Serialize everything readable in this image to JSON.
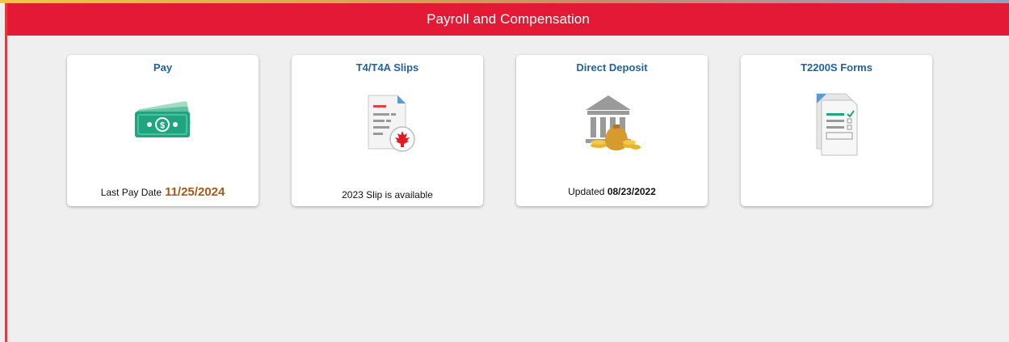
{
  "header": {
    "title": "Payroll and Compensation"
  },
  "tiles": {
    "pay": {
      "title": "Pay",
      "icon": "money-icon",
      "footer_label": "Last Pay Date",
      "footer_value": "11/25/2024"
    },
    "t4": {
      "title": "T4/T4A Slips",
      "icon": "tax-slip-maple-leaf-icon",
      "footer_label": "2023 Slip is available"
    },
    "deposit": {
      "title": "Direct Deposit",
      "icon": "bank-deposit-icon",
      "footer_label": "Updated",
      "footer_value": "08/23/2022"
    },
    "t2200s": {
      "title": "T2200S Forms",
      "icon": "form-checklist-icon"
    }
  },
  "colors": {
    "header_bg": "#e31936",
    "tile_title": "#1f62a3",
    "pay_date": "#a5591a",
    "page_bg": "#efefef"
  }
}
